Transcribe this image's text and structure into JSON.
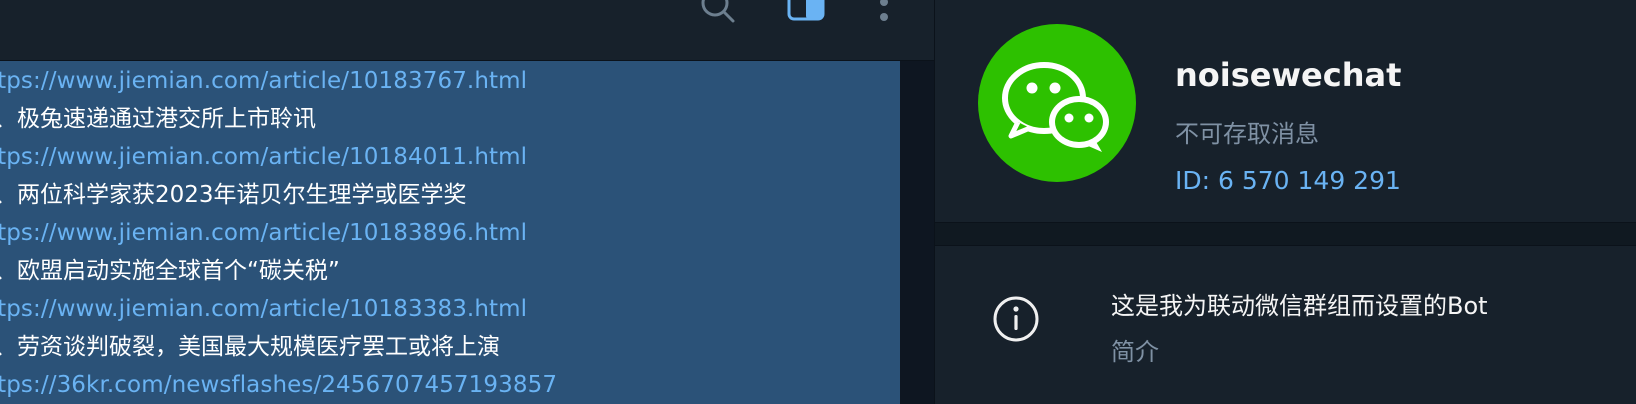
{
  "chat": {
    "header_icons": [
      "search-icon",
      "side-panel-icon",
      "more-vertical-icon"
    ],
    "message_lines": [
      {
        "kind": "link",
        "text": "ttps://www.jiemian.com/article/10183767.html"
      },
      {
        "kind": "text",
        "text": "、极兔速递通过港交所上市聆讯"
      },
      {
        "kind": "link",
        "text": "ttps://www.jiemian.com/article/10184011.html"
      },
      {
        "kind": "text",
        "text": "、两位科学家获2023年诺贝尔生理学或医学奖"
      },
      {
        "kind": "link",
        "text": "ttps://www.jiemian.com/article/10183896.html"
      },
      {
        "kind": "text",
        "text": "、欧盟启动实施全球首个“碳关税”"
      },
      {
        "kind": "link",
        "text": "ttps://www.jiemian.com/article/10183383.html"
      },
      {
        "kind": "text",
        "text": "、劳资谈判破裂，美国最大规模医疗罢工或将上演"
      },
      {
        "kind": "link",
        "text": "ttps://36kr.com/newsflashes/2456707457193857"
      }
    ]
  },
  "profile": {
    "avatar_icon": "wechat-logo",
    "name": "noisewechat",
    "status": "不可存取消息",
    "id_label": "ID: 6 570 149 291"
  },
  "about": {
    "icon": "info-icon",
    "text": "这是我为联动微信群组而设置的Bot",
    "label": "简介"
  },
  "colors": {
    "panel_bg": "#17212b",
    "chat_bg": "#0e1621",
    "bubble_bg": "#2b5278",
    "link": "#6ab3f3",
    "muted": "#7f91a4",
    "wechat_green": "#2dc100"
  }
}
